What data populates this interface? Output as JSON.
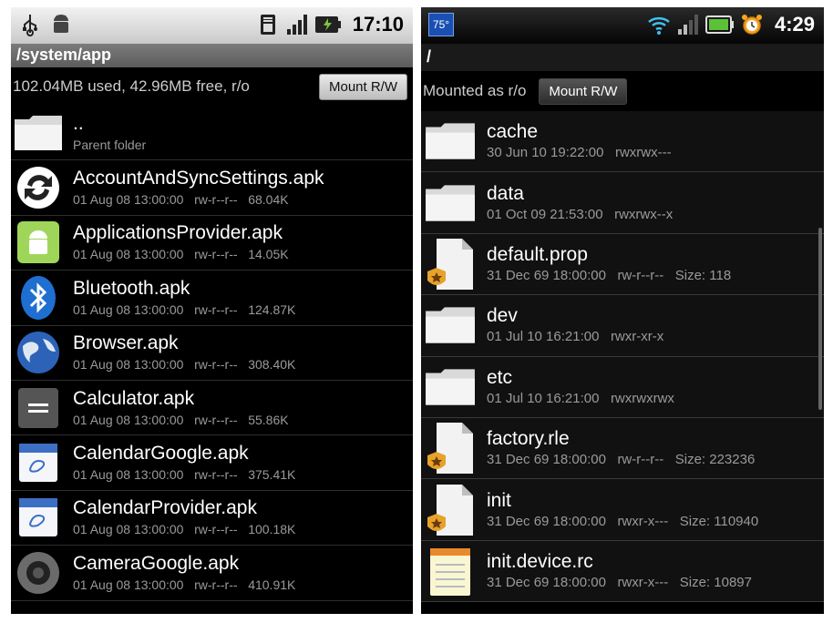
{
  "left": {
    "statusbar": {
      "time": "17:10",
      "icons": [
        "usb-icon",
        "android-debug-icon",
        "sim-icon",
        "signal-icon",
        "battery-charging-icon"
      ]
    },
    "path": "/system/app",
    "info": "102.04MB used, 42.96MB free, r/o",
    "mount_label": "Mount R/W",
    "rows": [
      {
        "name": "..",
        "meta": "Parent folder",
        "icon": "folder-icon"
      },
      {
        "name": "AccountAndSyncSettings.apk",
        "meta": "01 Aug 08 13:00:00   rw-r--r--   68.04K",
        "icon": "sync-icon"
      },
      {
        "name": "ApplicationsProvider.apk",
        "meta": "01 Aug 08 13:00:00   rw-r--r--   14.05K",
        "icon": "android-app-icon"
      },
      {
        "name": "Bluetooth.apk",
        "meta": "01 Aug 08 13:00:00   rw-r--r--   124.87K",
        "icon": "bluetooth-icon"
      },
      {
        "name": "Browser.apk",
        "meta": "01 Aug 08 13:00:00   rw-r--r--   308.40K",
        "icon": "globe-icon"
      },
      {
        "name": "Calculator.apk",
        "meta": "01 Aug 08 13:00:00   rw-r--r--   55.86K",
        "icon": "calculator-icon"
      },
      {
        "name": "CalendarGoogle.apk",
        "meta": "01 Aug 08 13:00:00   rw-r--r--   375.41K",
        "icon": "calendar-icon"
      },
      {
        "name": "CalendarProvider.apk",
        "meta": "01 Aug 08 13:00:00   rw-r--r--   100.18K",
        "icon": "calendar-icon"
      },
      {
        "name": "CameraGoogle.apk",
        "meta": "01 Aug 08 13:00:00   rw-r--r--   410.91K",
        "icon": "camera-icon"
      }
    ]
  },
  "right": {
    "statusbar": {
      "time": "4:29",
      "temp": "75°",
      "icons": [
        "wifi-icon",
        "signal-icon",
        "battery-icon",
        "alarm-clock-icon"
      ]
    },
    "path": "/",
    "info": "Mounted as r/o",
    "mount_label": "Mount R/W",
    "rows": [
      {
        "name": "cache",
        "meta": "30 Jun 10 19:22:00   rwxrwx---",
        "icon": "folder-icon"
      },
      {
        "name": "data",
        "meta": "01 Oct 09 21:53:00   rwxrwx--x",
        "icon": "folder-icon"
      },
      {
        "name": "default.prop",
        "meta": "31 Dec 69 18:00:00   rw-r--r--   Size: 118",
        "icon": "secure-file-icon"
      },
      {
        "name": "dev",
        "meta": "01 Jul 10 16:21:00   rwxr-xr-x",
        "icon": "folder-icon"
      },
      {
        "name": "etc",
        "meta": "01 Jul 10 16:21:00   rwxrwxrwx",
        "icon": "folder-icon"
      },
      {
        "name": "factory.rle",
        "meta": "31 Dec 69 18:00:00   rw-r--r--   Size: 223236",
        "icon": "secure-file-icon"
      },
      {
        "name": "init",
        "meta": "31 Dec 69 18:00:00   rwxr-x---   Size: 110940",
        "icon": "secure-file-icon"
      },
      {
        "name": "init.device.rc",
        "meta": "31 Dec 69 18:00:00   rwxr-x---   Size: 10897",
        "icon": "notepad-icon"
      }
    ]
  }
}
